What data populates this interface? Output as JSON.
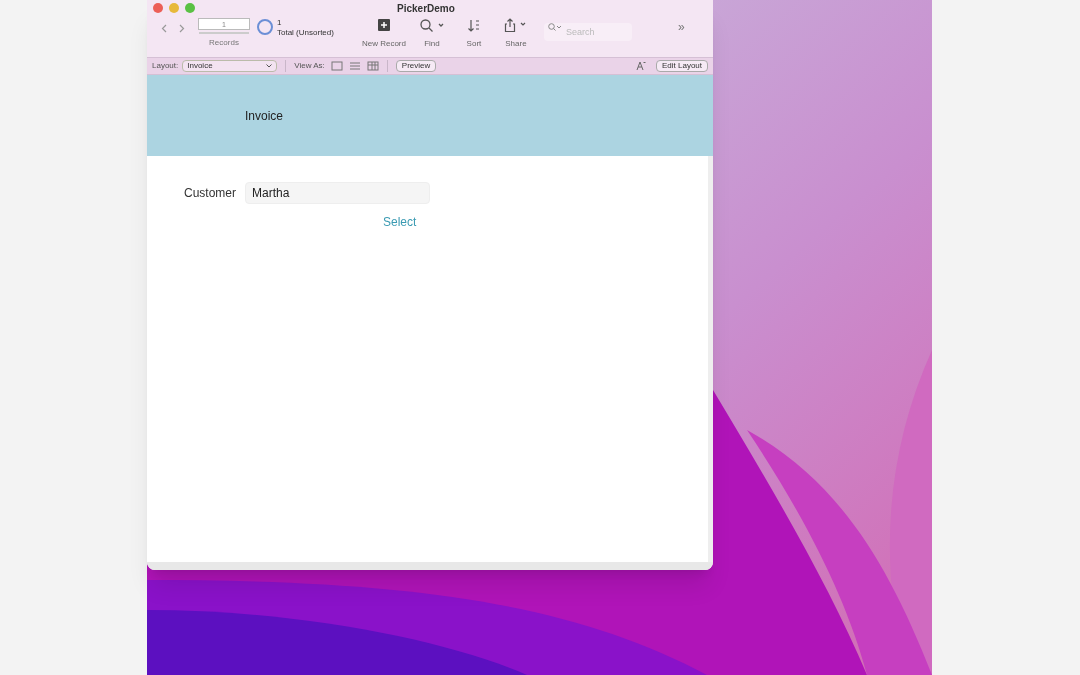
{
  "window": {
    "title": "PickerDemo"
  },
  "toolbar": {
    "record_field": "1",
    "record_count": "1",
    "record_status": "Total (Unsorted)",
    "records_label": "Records",
    "buttons": [
      {
        "kind": "new",
        "label": "New Record"
      },
      {
        "kind": "find",
        "label": "Find"
      },
      {
        "kind": "sort",
        "label": "Sort"
      },
      {
        "kind": "share",
        "label": "Share"
      }
    ],
    "search": {
      "placeholder": "Search"
    },
    "overflow": "»"
  },
  "layout_bar": {
    "layout_label": "Layout:",
    "layout_value": "Invoice",
    "view_as_label": "View As:",
    "views": [
      {
        "kind": "form",
        "selected": false
      },
      {
        "kind": "list",
        "selected": false
      },
      {
        "kind": "table",
        "selected": false
      }
    ],
    "preview": "Preview",
    "edit_layout": "Edit Layout"
  },
  "header": {
    "title": "Invoice"
  },
  "form": {
    "customer_label": "Customer",
    "customer_value": "Martha",
    "select_link": "Select"
  }
}
